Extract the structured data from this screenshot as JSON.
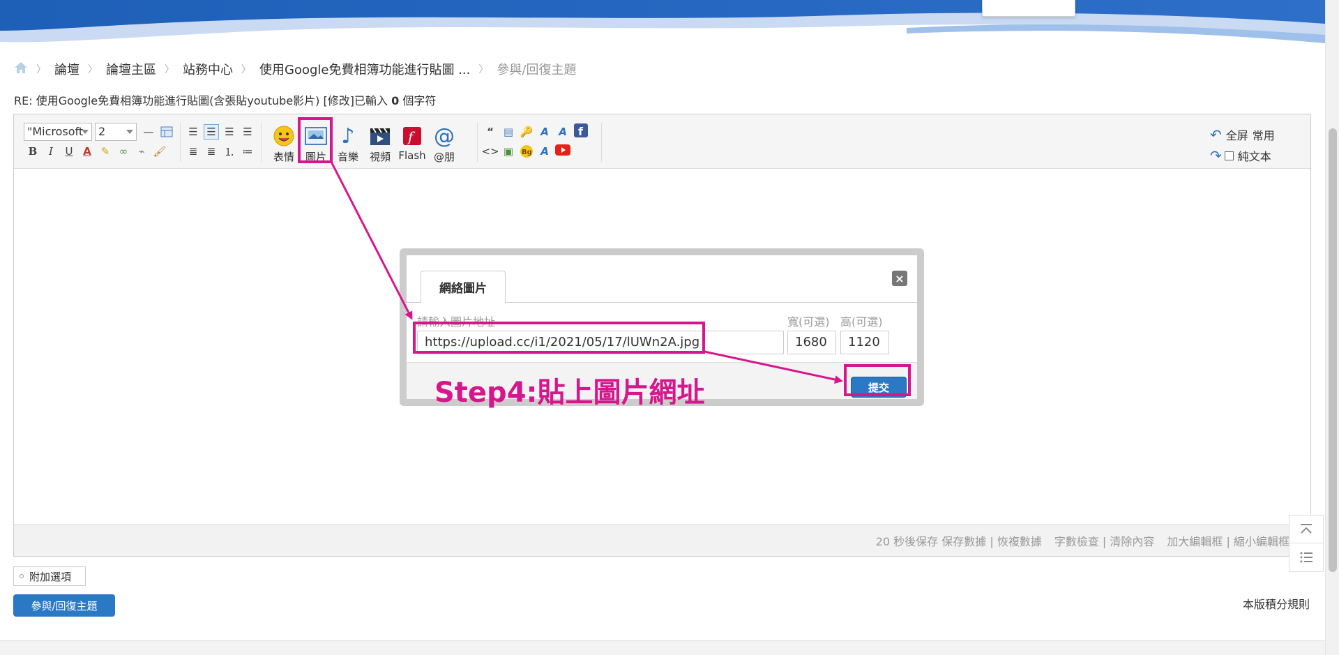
{
  "breadcrumb": {
    "items": [
      "論壇",
      "論壇主區",
      "站務中心",
      "使用Google免費相簿功能進行貼圖 ...",
      "參與/回復主題"
    ]
  },
  "subject": {
    "prefix": "RE: 使用Google免費相簿功能進行貼圖(含張貼youtube影片) [修改]已輸入 ",
    "count": "0",
    "suffix": " 個字符"
  },
  "toolbar": {
    "font_value": "\"Microsoft",
    "size_value": "2",
    "big_buttons": [
      "表情",
      "圖片",
      "音樂",
      "視頻",
      "Flash",
      "@朋"
    ],
    "fullscreen_label": "全屏",
    "common_label": "常用",
    "plaintext_label": "純文本"
  },
  "dialog": {
    "tab_label": "網絡圖片",
    "url_label": "請輸入圖片地址",
    "url_value": "https://upload.cc/i1/2021/05/17/lUWn2A.jpg",
    "width_label": "寬(可選)",
    "width_value": "1680",
    "height_label": "高(可選)",
    "height_value": "1120",
    "submit_label": "提交",
    "close_label": "×"
  },
  "annotation": {
    "step_text": "Step4:貼上圖片網址",
    "color": "#d6168c"
  },
  "editor_footer": {
    "autosave": "20 秒後保存 保存數據 | 恢複數據",
    "tools": "字數檢查 | 清除內容",
    "resize": "加大編輯框 | 縮小編輯框"
  },
  "bottom": {
    "extra_options": "附加選項",
    "reply_button": "參與/回復主題",
    "rules_link": "本版積分規則"
  },
  "colors": {
    "accent": "#2b78c5",
    "highlight": "#d6168c"
  }
}
